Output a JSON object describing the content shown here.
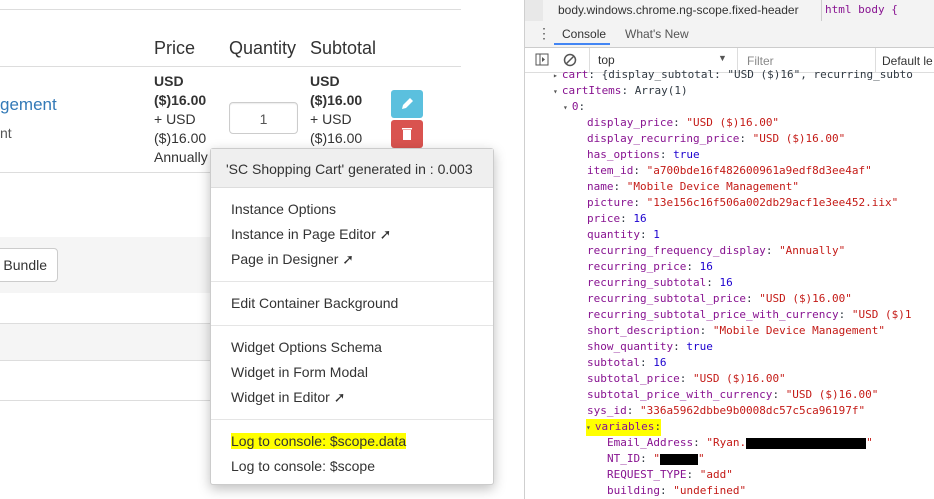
{
  "cart": {
    "headers": {
      "price": "Price",
      "quantity": "Quantity",
      "subtotal": "Subtotal"
    },
    "item": {
      "name_fragment": "gement",
      "desc_fragment": "nt",
      "price_lines": [
        "USD",
        "($)16.00",
        "+ USD",
        "($)16.00",
        "Annually"
      ],
      "quantity": "1",
      "subtotal_lines": [
        "USD",
        "($)16.00",
        "+ USD",
        "($)16.00"
      ]
    },
    "bundle_label": "Bundle"
  },
  "menu": {
    "header": "'SC Shopping Cart' generated in : 0.003",
    "group1": [
      "Instance Options",
      "Instance in Page Editor ➚",
      "Page in Designer ➚"
    ],
    "group2": [
      "Edit Container Background"
    ],
    "group3": [
      "Widget Options Schema",
      "Widget in Form Modal",
      "Widget in Editor ➚"
    ],
    "group4": [
      "Log to console: $scope.data",
      "Log to console: $scope"
    ]
  },
  "devtools": {
    "breadcrumb": "body.windows.chrome.ng-scope.fixed-header",
    "breadcrumb_right": "html  body {",
    "tabs": {
      "console": "Console",
      "whats_new": "What's New"
    },
    "context": "top",
    "filter_placeholder": "Filter",
    "levels": "Default le",
    "lines": [
      {
        "indent": 0,
        "tri": "▸",
        "key": "cart",
        "sep": ": ",
        "val": "{display_subtotal: \"USD ($)16\", recurring_subto",
        "cls": "p"
      },
      {
        "indent": 0,
        "tri": "▾",
        "key": "cartItems",
        "sep": ": ",
        "val": "Array(1)",
        "cls": "p"
      },
      {
        "indent": 1,
        "tri": "▾",
        "key": "0",
        "sep": ":",
        "val": "",
        "cls": "p"
      },
      {
        "indent": 2,
        "key": "display_price",
        "sep": ": ",
        "val": "\"USD ($)16.00\"",
        "cls": "s"
      },
      {
        "indent": 2,
        "key": "display_recurring_price",
        "sep": ": ",
        "val": "\"USD ($)16.00\"",
        "cls": "s"
      },
      {
        "indent": 2,
        "key": "has_options",
        "sep": ": ",
        "val": "true",
        "cls": "n"
      },
      {
        "indent": 2,
        "key": "item_id",
        "sep": ": ",
        "val": "\"a700bde16f482600961a9edf8d3ee4af\"",
        "cls": "s"
      },
      {
        "indent": 2,
        "key": "name",
        "sep": ": ",
        "val": "\"Mobile Device Management\"",
        "cls": "s"
      },
      {
        "indent": 2,
        "key": "picture",
        "sep": ": ",
        "val": "\"13e156c16f506a002db29acf1e3ee452.iix\"",
        "cls": "s"
      },
      {
        "indent": 2,
        "key": "price",
        "sep": ": ",
        "val": "16",
        "cls": "n"
      },
      {
        "indent": 2,
        "key": "quantity",
        "sep": ": ",
        "val": "1",
        "cls": "n"
      },
      {
        "indent": 2,
        "key": "recurring_frequency_display",
        "sep": ": ",
        "val": "\"Annually\"",
        "cls": "s"
      },
      {
        "indent": 2,
        "key": "recurring_price",
        "sep": ": ",
        "val": "16",
        "cls": "n"
      },
      {
        "indent": 2,
        "key": "recurring_subtotal",
        "sep": ": ",
        "val": "16",
        "cls": "n"
      },
      {
        "indent": 2,
        "key": "recurring_subtotal_price",
        "sep": ": ",
        "val": "\"USD ($)16.00\"",
        "cls": "s"
      },
      {
        "indent": 2,
        "key": "recurring_subtotal_price_with_currency",
        "sep": ": ",
        "val": "\"USD ($)1",
        "cls": "s"
      },
      {
        "indent": 2,
        "key": "short_description",
        "sep": ": ",
        "val": "\"Mobile Device Management\"",
        "cls": "s"
      },
      {
        "indent": 2,
        "key": "show_quantity",
        "sep": ": ",
        "val": "true",
        "cls": "n"
      },
      {
        "indent": 2,
        "key": "subtotal",
        "sep": ": ",
        "val": "16",
        "cls": "n"
      },
      {
        "indent": 2,
        "key": "subtotal_price",
        "sep": ": ",
        "val": "\"USD ($)16.00\"",
        "cls": "s"
      },
      {
        "indent": 2,
        "key": "subtotal_price_with_currency",
        "sep": ": ",
        "val": "\"USD ($)16.00\"",
        "cls": "s"
      },
      {
        "indent": 2,
        "key": "sys_id",
        "sep": ": ",
        "val": "\"336a5962dbbe9b0008dc57c5ca96197f\"",
        "cls": "s"
      },
      {
        "indent": 1,
        "tri": "▾",
        "key": "variables",
        "sep": ":",
        "val": "",
        "cls": "p",
        "highlight": true
      },
      {
        "indent": 3,
        "key": "Email_Address",
        "sep": ": ",
        "val": "\"Ryan.",
        "cls": "s",
        "redact": 120,
        "tail": "\""
      },
      {
        "indent": 3,
        "key": "NT_ID",
        "sep": ": ",
        "val": "\"",
        "cls": "s",
        "redact": 38,
        "tail": "\""
      },
      {
        "indent": 3,
        "key": "REQUEST_TYPE",
        "sep": ": ",
        "val": "\"add\"",
        "cls": "s"
      },
      {
        "indent": 3,
        "key": "building",
        "sep": ": ",
        "val": "\"undefined\"",
        "cls": "s"
      }
    ]
  }
}
